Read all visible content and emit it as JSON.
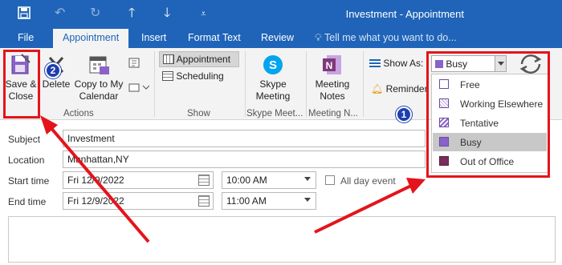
{
  "window": {
    "title": "Investment  -  Appointment"
  },
  "qat": {
    "save_icon": "save-icon",
    "undo_icon": "undo-icon",
    "redo_icon": "redo-icon",
    "up_icon": "arrow-up-icon",
    "down_icon": "arrow-down-icon",
    "customize_icon": "customize-qat-icon"
  },
  "tabs": [
    {
      "label": "File"
    },
    {
      "label": "Appointment"
    },
    {
      "label": "Insert"
    },
    {
      "label": "Format Text"
    },
    {
      "label": "Review"
    }
  ],
  "tell_me": "Tell me what you want to do...",
  "ribbon": {
    "save_close": {
      "line1": "Save &",
      "line2": "Close"
    },
    "delete": "Delete",
    "copy_calendar": {
      "line1": "Copy to My",
      "line2": "Calendar"
    },
    "actions_label": "Actions",
    "appointment": "Appointment",
    "scheduling": "Scheduling",
    "show_label": "Show",
    "skype": {
      "line1": "Skype",
      "line2": "Meeting"
    },
    "skype_label": "Skype Meet...",
    "meeting_notes": {
      "line1": "Meeting",
      "line2": "Notes"
    },
    "meeting_notes_label": "Meeting N...",
    "show_as_label": "Show As:",
    "show_as_value": "Busy",
    "reminder_label": "Reminder"
  },
  "show_as_options": [
    {
      "label": "Free",
      "color": "#ffffff"
    },
    {
      "label": "Working Elsewhere",
      "color": "#d9c8ee"
    },
    {
      "label": "Tentative",
      "color": "#b89ee0"
    },
    {
      "label": "Busy",
      "color": "#8a63c9",
      "selected": true
    },
    {
      "label": "Out of Office",
      "color": "#7a2d5a"
    }
  ],
  "form": {
    "subject_label": "Subject",
    "subject_value": "Investment",
    "location_label": "Location",
    "location_value": "Manhattan,NY",
    "start_label": "Start time",
    "start_date": "Fri 12/9/2022",
    "start_time": "10:00 AM",
    "all_day_label": "All day event",
    "end_label": "End time",
    "end_date": "Fri 12/9/2022",
    "end_time": "11:00 AM"
  },
  "annotations": {
    "badge1": "1",
    "badge2": "2"
  },
  "colors": {
    "titlebar": "#1f64b8",
    "ribbon": "#f3f3f3",
    "annotation_red": "#e4141b",
    "badge_blue": "#1d3fae"
  }
}
